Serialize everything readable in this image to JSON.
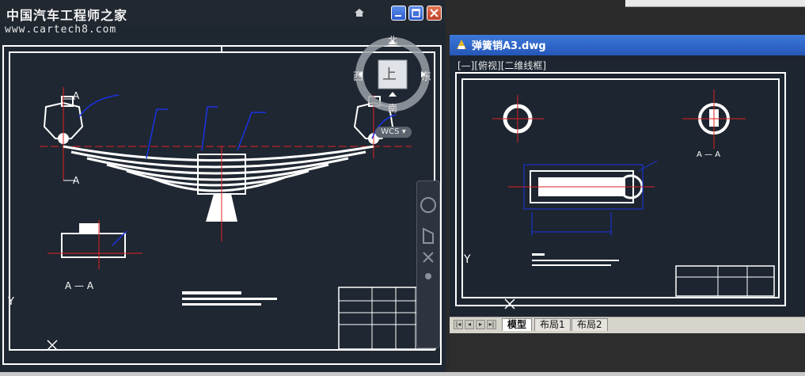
{
  "left_window": {
    "title": "中国汽车工程师之家",
    "url": "www.cartech8.com",
    "viewcube": {
      "north": "北",
      "south": "南",
      "east": "东",
      "west": "西",
      "top": "上",
      "wcs": "WCS"
    },
    "section_labels": [
      "A",
      "A",
      "A — A"
    ],
    "axis_label": "Y"
  },
  "right_window": {
    "title": "弹簧销A3.dwg",
    "view_label": "[—][俯视][二维线框]",
    "axis_label": "Y",
    "section_label": "A — A",
    "tabs": [
      "模型",
      "布局1",
      "布局2"
    ],
    "active_tab": "模型"
  },
  "colors": {
    "drawing_bg": "#1f2732",
    "titlebar_blue": "#2f68c8",
    "cad_line": "#ffffff",
    "cad_red": "#e02020",
    "cad_blue": "#1a33e6"
  }
}
